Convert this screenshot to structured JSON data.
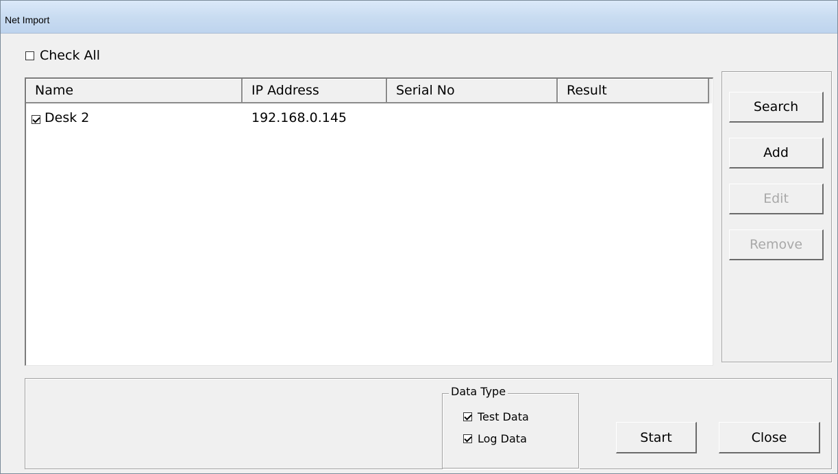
{
  "window": {
    "title": "Net Import"
  },
  "check_all": {
    "label": "Check All",
    "checked": false
  },
  "list": {
    "columns": [
      "Name",
      "IP Address",
      "Serial No",
      "Result"
    ],
    "rows": [
      {
        "checked": true,
        "name": "Desk 2",
        "ip": "192.168.0.145",
        "serial": "",
        "result": ""
      }
    ]
  },
  "side_buttons": {
    "search": "Search",
    "add": "Add",
    "edit": "Edit",
    "remove": "Remove"
  },
  "data_type": {
    "legend": "Data Type",
    "test_data": {
      "label": "Test Data",
      "checked": true
    },
    "log_data": {
      "label": "Log Data",
      "checked": true
    }
  },
  "footer_buttons": {
    "start": "Start",
    "close": "Close"
  }
}
